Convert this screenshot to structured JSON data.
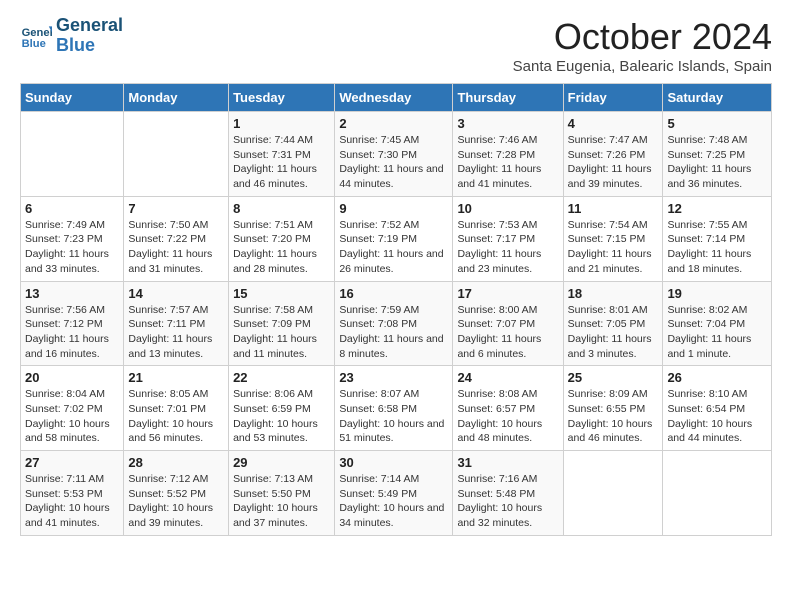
{
  "header": {
    "logo_line1": "General",
    "logo_line2": "Blue",
    "month_title": "October 2024",
    "subtitle": "Santa Eugenia, Balearic Islands, Spain"
  },
  "weekdays": [
    "Sunday",
    "Monday",
    "Tuesday",
    "Wednesday",
    "Thursday",
    "Friday",
    "Saturday"
  ],
  "weeks": [
    [
      {
        "day": "",
        "content": ""
      },
      {
        "day": "",
        "content": ""
      },
      {
        "day": "1",
        "content": "Sunrise: 7:44 AM\nSunset: 7:31 PM\nDaylight: 11 hours and 46 minutes."
      },
      {
        "day": "2",
        "content": "Sunrise: 7:45 AM\nSunset: 7:30 PM\nDaylight: 11 hours and 44 minutes."
      },
      {
        "day": "3",
        "content": "Sunrise: 7:46 AM\nSunset: 7:28 PM\nDaylight: 11 hours and 41 minutes."
      },
      {
        "day": "4",
        "content": "Sunrise: 7:47 AM\nSunset: 7:26 PM\nDaylight: 11 hours and 39 minutes."
      },
      {
        "day": "5",
        "content": "Sunrise: 7:48 AM\nSunset: 7:25 PM\nDaylight: 11 hours and 36 minutes."
      }
    ],
    [
      {
        "day": "6",
        "content": "Sunrise: 7:49 AM\nSunset: 7:23 PM\nDaylight: 11 hours and 33 minutes."
      },
      {
        "day": "7",
        "content": "Sunrise: 7:50 AM\nSunset: 7:22 PM\nDaylight: 11 hours and 31 minutes."
      },
      {
        "day": "8",
        "content": "Sunrise: 7:51 AM\nSunset: 7:20 PM\nDaylight: 11 hours and 28 minutes."
      },
      {
        "day": "9",
        "content": "Sunrise: 7:52 AM\nSunset: 7:19 PM\nDaylight: 11 hours and 26 minutes."
      },
      {
        "day": "10",
        "content": "Sunrise: 7:53 AM\nSunset: 7:17 PM\nDaylight: 11 hours and 23 minutes."
      },
      {
        "day": "11",
        "content": "Sunrise: 7:54 AM\nSunset: 7:15 PM\nDaylight: 11 hours and 21 minutes."
      },
      {
        "day": "12",
        "content": "Sunrise: 7:55 AM\nSunset: 7:14 PM\nDaylight: 11 hours and 18 minutes."
      }
    ],
    [
      {
        "day": "13",
        "content": "Sunrise: 7:56 AM\nSunset: 7:12 PM\nDaylight: 11 hours and 16 minutes."
      },
      {
        "day": "14",
        "content": "Sunrise: 7:57 AM\nSunset: 7:11 PM\nDaylight: 11 hours and 13 minutes."
      },
      {
        "day": "15",
        "content": "Sunrise: 7:58 AM\nSunset: 7:09 PM\nDaylight: 11 hours and 11 minutes."
      },
      {
        "day": "16",
        "content": "Sunrise: 7:59 AM\nSunset: 7:08 PM\nDaylight: 11 hours and 8 minutes."
      },
      {
        "day": "17",
        "content": "Sunrise: 8:00 AM\nSunset: 7:07 PM\nDaylight: 11 hours and 6 minutes."
      },
      {
        "day": "18",
        "content": "Sunrise: 8:01 AM\nSunset: 7:05 PM\nDaylight: 11 hours and 3 minutes."
      },
      {
        "day": "19",
        "content": "Sunrise: 8:02 AM\nSunset: 7:04 PM\nDaylight: 11 hours and 1 minute."
      }
    ],
    [
      {
        "day": "20",
        "content": "Sunrise: 8:04 AM\nSunset: 7:02 PM\nDaylight: 10 hours and 58 minutes."
      },
      {
        "day": "21",
        "content": "Sunrise: 8:05 AM\nSunset: 7:01 PM\nDaylight: 10 hours and 56 minutes."
      },
      {
        "day": "22",
        "content": "Sunrise: 8:06 AM\nSunset: 6:59 PM\nDaylight: 10 hours and 53 minutes."
      },
      {
        "day": "23",
        "content": "Sunrise: 8:07 AM\nSunset: 6:58 PM\nDaylight: 10 hours and 51 minutes."
      },
      {
        "day": "24",
        "content": "Sunrise: 8:08 AM\nSunset: 6:57 PM\nDaylight: 10 hours and 48 minutes."
      },
      {
        "day": "25",
        "content": "Sunrise: 8:09 AM\nSunset: 6:55 PM\nDaylight: 10 hours and 46 minutes."
      },
      {
        "day": "26",
        "content": "Sunrise: 8:10 AM\nSunset: 6:54 PM\nDaylight: 10 hours and 44 minutes."
      }
    ],
    [
      {
        "day": "27",
        "content": "Sunrise: 7:11 AM\nSunset: 5:53 PM\nDaylight: 10 hours and 41 minutes."
      },
      {
        "day": "28",
        "content": "Sunrise: 7:12 AM\nSunset: 5:52 PM\nDaylight: 10 hours and 39 minutes."
      },
      {
        "day": "29",
        "content": "Sunrise: 7:13 AM\nSunset: 5:50 PM\nDaylight: 10 hours and 37 minutes."
      },
      {
        "day": "30",
        "content": "Sunrise: 7:14 AM\nSunset: 5:49 PM\nDaylight: 10 hours and 34 minutes."
      },
      {
        "day": "31",
        "content": "Sunrise: 7:16 AM\nSunset: 5:48 PM\nDaylight: 10 hours and 32 minutes."
      },
      {
        "day": "",
        "content": ""
      },
      {
        "day": "",
        "content": ""
      }
    ]
  ]
}
